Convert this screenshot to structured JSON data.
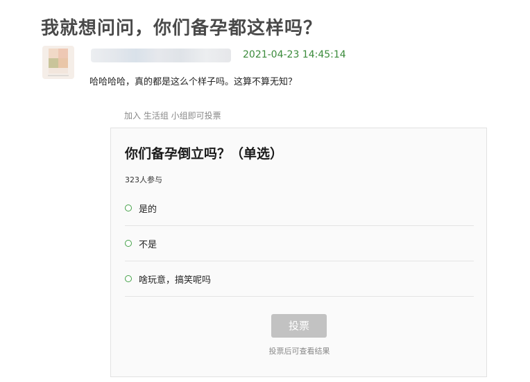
{
  "post": {
    "title": "我就想问问，你们备孕都这样吗？",
    "date": "2021-04-23 14:45:14",
    "content": "哈哈哈哈，真的都是这么个样子吗。这算不算无知？"
  },
  "poll": {
    "join_hint": "加入 生活组 小组即可投票",
    "question": "你们备孕倒立吗？（单选）",
    "participants": "323人参与",
    "options": [
      {
        "label": "是的"
      },
      {
        "label": "不是"
      },
      {
        "label": "啥玩意，搞笑呢吗"
      }
    ],
    "vote_label": "投票",
    "vote_hint": "投票后可查看结果"
  },
  "colors": {
    "accent_green": "#3a8a3a",
    "radio_green": "#43a047",
    "button_disabled": "#c2c2c2"
  }
}
